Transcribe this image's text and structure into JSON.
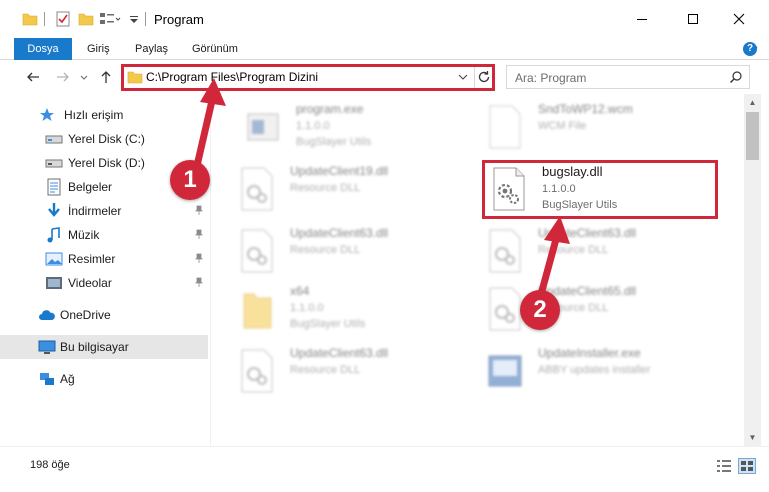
{
  "window": {
    "title": "Program",
    "minimize_icon": "minimize-icon",
    "maximize_icon": "maximize-icon",
    "close_icon": "close-icon"
  },
  "ribbon": {
    "tabs": [
      {
        "label": "Dosya"
      },
      {
        "label": "Giriş"
      },
      {
        "label": "Paylaş"
      },
      {
        "label": "Görünüm"
      }
    ]
  },
  "address_bar": {
    "path": "C:\\Program Files\\Program Dizini",
    "search_placeholder": "Ara: Program"
  },
  "nav_pane": {
    "items": [
      {
        "label": "Hızlı erişim",
        "icon": "star-icon",
        "pinned": false
      },
      {
        "label": "Yerel Disk (C:)",
        "icon": "drive-icon",
        "pinned": false
      },
      {
        "label": "Yerel Disk (D:)",
        "icon": "drive-icon",
        "pinned": false
      },
      {
        "label": "Belgeler",
        "icon": "document-icon",
        "pinned": false
      },
      {
        "label": "İndirmeler",
        "icon": "download-icon",
        "pinned": true
      },
      {
        "label": "Müzik",
        "icon": "music-icon",
        "pinned": true
      },
      {
        "label": "Resimler",
        "icon": "pictures-icon",
        "pinned": true
      },
      {
        "label": "Videolar",
        "icon": "video-icon",
        "pinned": true
      },
      {
        "label": "OneDrive",
        "icon": "cloud-icon",
        "pinned": false
      },
      {
        "label": "Bu bilgisayar",
        "icon": "computer-icon",
        "pinned": false
      },
      {
        "label": "Ağ",
        "icon": "network-icon",
        "pinned": false
      }
    ]
  },
  "files": [
    {
      "name": "program.exe",
      "version": "1.1.0.0",
      "description": "BugSlayer Utils"
    },
    {
      "name": "SndToWP12.wcm",
      "version": "WCM File",
      "description": ""
    },
    {
      "name": "UpdateClient19.dll",
      "version": "Resource DLL",
      "description": ""
    },
    {
      "name": "bugslay.dll",
      "version": "1.1.0.0",
      "description": "BugSlayer Utils"
    },
    {
      "name": "UpdateClient63.dll",
      "version": "Resource DLL",
      "description": ""
    },
    {
      "name": "UpdateClient63.dll",
      "version": "Resource DLL",
      "description": ""
    },
    {
      "name": "x64",
      "version": "1.1.0.0",
      "description": "BugSlayer Utils"
    },
    {
      "name": "UpdateClient65.dll",
      "version": "Resource DLL",
      "description": ""
    },
    {
      "name": "UpdateClient63.dll",
      "version": "Resource DLL",
      "description": ""
    },
    {
      "name": "UpdateInstaller.exe",
      "version": "ABBY updates installer",
      "description": ""
    }
  ],
  "annotations": {
    "badge1": "1",
    "badge2": "2"
  },
  "status_bar": {
    "item_count": "198 öğe"
  },
  "colors": {
    "accent": "#1979ca",
    "highlight": "#d0283a"
  }
}
